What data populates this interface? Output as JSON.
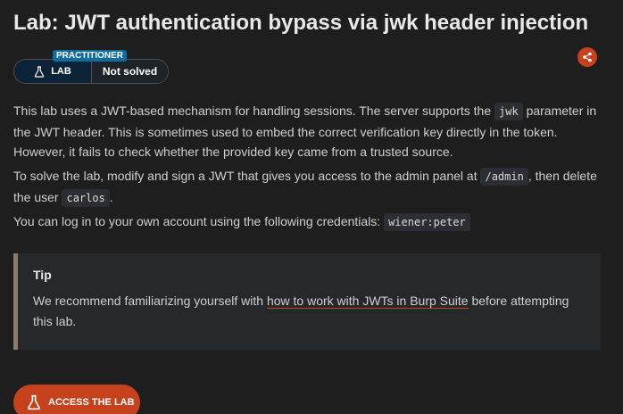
{
  "title": "Lab: JWT authentication bypass via jwk header injection",
  "badge": {
    "level": "PRACTITIONER",
    "lab_label": "LAB",
    "status": "Not solved"
  },
  "share_icon": "share-icon",
  "paragraph1": {
    "part1": "This lab uses a JWT-based mechanism for handling sessions. The server supports the ",
    "code": "jwk",
    "part2": " parameter in the JWT header. This is sometimes used to embed the correct verification key directly in the token. However, it fails to check whether the provided key came from a trusted source."
  },
  "paragraph2": {
    "part1": "To solve the lab, modify and sign a JWT that gives you access to the admin panel at ",
    "code1": "/admin",
    "part2": ", then delete the user ",
    "code2": "carlos",
    "part3": "."
  },
  "paragraph3": {
    "part1": "You can log in to your own account using the following credentials: ",
    "code": "wiener:peter"
  },
  "tip": {
    "title": "Tip",
    "before": "We recommend familiarizing yourself with ",
    "link": "how to work with JWTs in Burp Suite",
    "after": " before attempting this lab."
  },
  "access_button": "ACCESS THE LAB",
  "colors": {
    "accent": "#c6421c",
    "level_badge": "#0f6d9e",
    "background": "#1e1e1e"
  }
}
